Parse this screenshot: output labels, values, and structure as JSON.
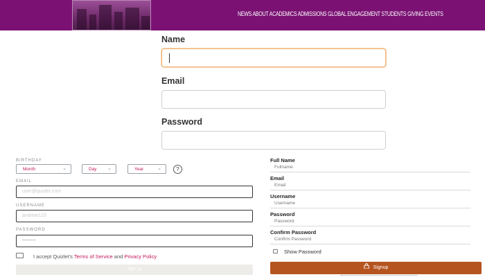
{
  "header": {
    "nav_text": "NEWS ABOUT ACADEMICS ADMISSIONS GLOBAL ENGAGEMENT STUDENTS GIVING EVENTS",
    "colors": {
      "banner": "#7a1173"
    }
  },
  "top_form": {
    "name_label": "Name",
    "email_label": "Email",
    "password_label": "Password"
  },
  "left_form": {
    "birthday_label": "BIRTHDAY",
    "month": "Month",
    "day": "Day",
    "year": "Year",
    "help_icon": "?",
    "email_label": "EMAIL",
    "email_placeholder": "user@quizlet.com",
    "username_label": "USERNAME",
    "username_placeholder": "andrew123",
    "password_label": "PASSWORD",
    "password_placeholder": "••••••••",
    "accept_prefix": "I accept Quizlet's",
    "terms_link": "Terms of Service",
    "and": "and",
    "privacy_link": "Privacy Policy",
    "signup_label": "Sign up",
    "colors": {
      "link": "#c2185b"
    }
  },
  "right_form": {
    "fullname_label": "Full Name",
    "fullname_placeholder": "Fullname",
    "email_label": "Email",
    "email_placeholder": "Email",
    "username_label": "Username",
    "username_placeholder": "Username",
    "password_label": "Password",
    "password_placeholder": "Password",
    "confirm_label": "Confirm Password",
    "confirm_placeholder": "Confirm Password",
    "show_password_label": "Show Password",
    "signup_label": "Signup",
    "colors": {
      "button": "#b5541f"
    }
  }
}
